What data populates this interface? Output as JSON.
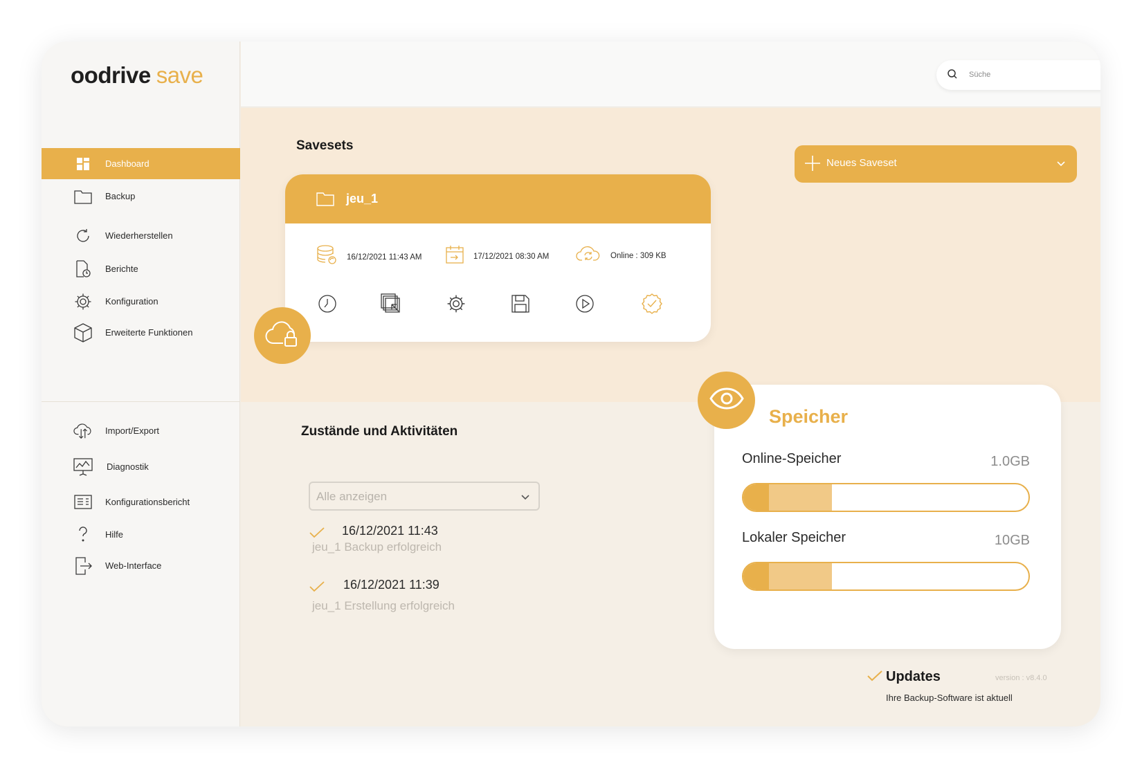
{
  "brand": {
    "logo_part1": "oodrive",
    "logo_part2": "save",
    "accent_color": "#e8b04b"
  },
  "search": {
    "placeholder": "Süche"
  },
  "sidebar": {
    "primary": [
      {
        "label": "Dashboard",
        "icon": "dashboard-grid-icon",
        "active": true
      },
      {
        "label": "Backup",
        "icon": "folder-icon"
      },
      {
        "label": "Wiederherstellen",
        "icon": "restore-icon"
      },
      {
        "label": "Berichte",
        "icon": "report-icon"
      },
      {
        "label": "Konfiguration",
        "icon": "gear-icon"
      },
      {
        "label": "Erweiterte Funktionen",
        "icon": "cube-icon"
      }
    ],
    "secondary": [
      {
        "label": "Import/Export",
        "icon": "cloud-transfer-icon"
      },
      {
        "label": "Diagnostik",
        "icon": "diagnostic-chart-icon"
      },
      {
        "label": "Konfigurationsbericht",
        "icon": "config-report-icon"
      },
      {
        "label": "Hilfe",
        "icon": "help-icon"
      },
      {
        "label": "Web-Interface",
        "icon": "exit-icon"
      }
    ]
  },
  "savesets": {
    "title": "Savesets",
    "new_button": "Neues Saveset",
    "card": {
      "name": "jeu_1",
      "last_backup": "16/12/2021 11:43 AM",
      "next_backup": "17/12/2021 08:30 AM",
      "online": "Online : 309 KB",
      "actions": [
        "schedule-icon",
        "select-files-icon",
        "settings-icon",
        "save-icon",
        "play-icon",
        "verified-icon"
      ]
    }
  },
  "activities": {
    "title": "Zustände und Aktivitäten",
    "filter": "Alle anzeigen",
    "items": [
      {
        "date": "16/12/2021 11:43",
        "desc": "jeu_1 Backup erfolgreich"
      },
      {
        "date": "16/12/2021 11:39",
        "desc": "jeu_1 Erstellung erfolgreich"
      }
    ]
  },
  "storage": {
    "title": "Speicher",
    "online": {
      "label": "Online-Speicher",
      "value": "1.0GB",
      "used_fraction": 0.09,
      "reserved_fraction": 0.22
    },
    "local": {
      "label": "Lokaler Speicher",
      "value": "10GB",
      "used_fraction": 0.09,
      "reserved_fraction": 0.22
    }
  },
  "updates": {
    "title": "Updates",
    "version": "version : v8.4.0",
    "status": "Ihre Backup-Software ist aktuell"
  }
}
